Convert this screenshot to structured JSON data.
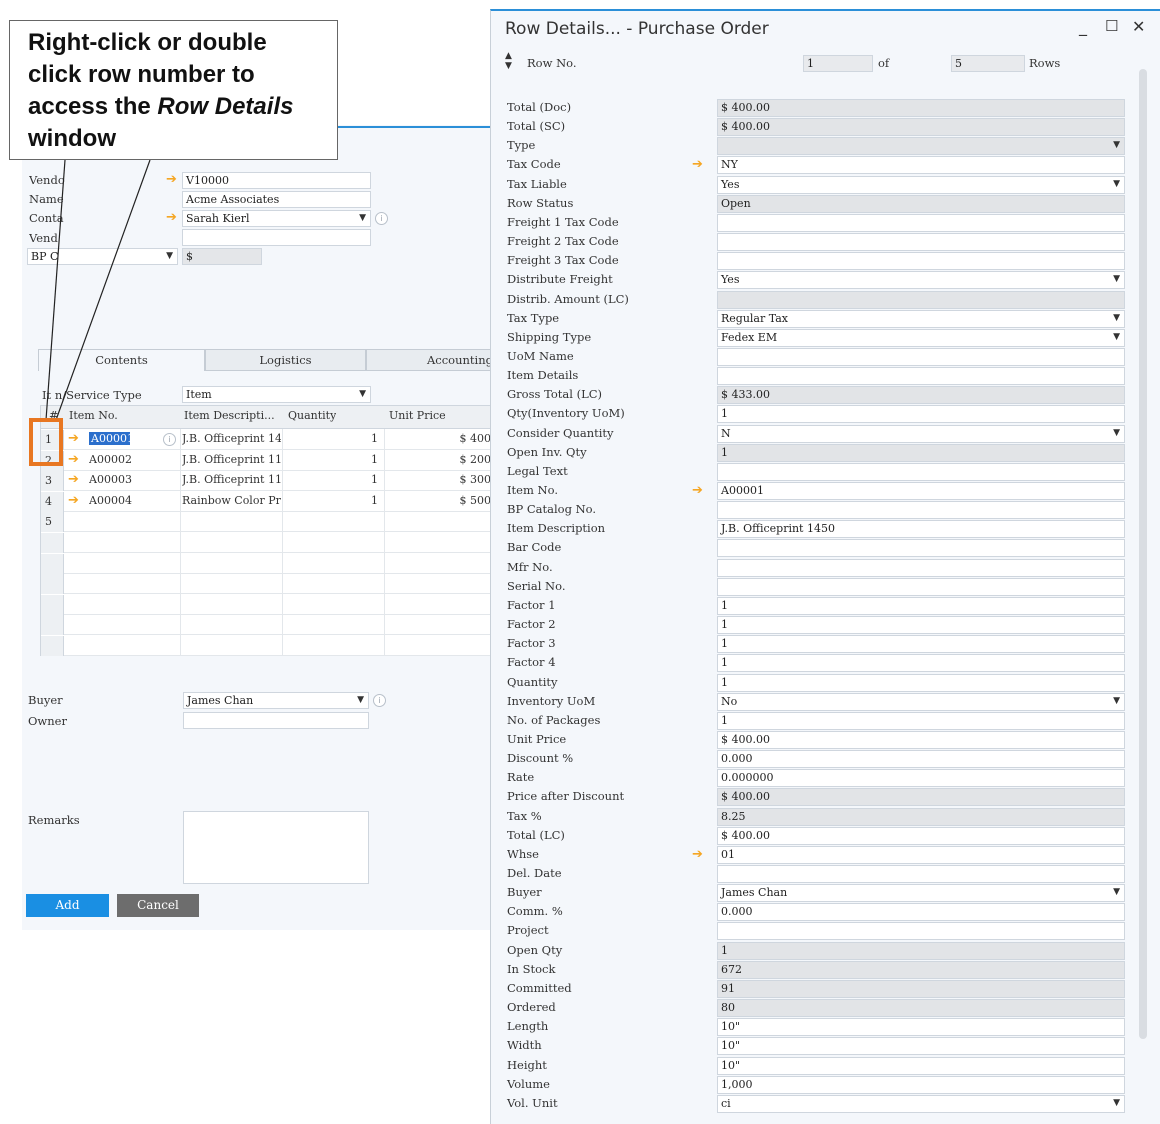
{
  "callout": {
    "line1": "Right-click or double",
    "line2": "click row number to",
    "line3_prefix": "access the ",
    "line3_em": "Row Details",
    "line4": "window"
  },
  "form": {
    "vendor_label": "Vendo",
    "vendor_value": "V10000",
    "name_label": "Name",
    "name_value": "Acme Associates",
    "contact_label": "Conta",
    "contact_value": "Sarah Kierl",
    "vendor_ref_label": "Vend",
    "vendor_ref_suffix": "",
    "bp_currency_label": "BP C",
    "currency_symbol": "$",
    "tabs": [
      "Contents",
      "Logistics",
      "Accounting"
    ],
    "item_service_label": "It  n/Service Type",
    "item_service_value": "Item",
    "grid_headers": [
      "#",
      "Item No.",
      "Item Descripti...",
      "Quantity",
      "Unit Price"
    ],
    "rows": [
      {
        "num": "1",
        "item": "A00001",
        "desc": "J.B. Officeprint 14",
        "qty": "1",
        "price": "$ 400"
      },
      {
        "num": "2",
        "item": "A00002",
        "desc": "J.B. Officeprint 11",
        "qty": "1",
        "price": "$ 200"
      },
      {
        "num": "3",
        "item": "A00003",
        "desc": "J.B. Officeprint 11",
        "qty": "1",
        "price": "$ 300"
      },
      {
        "num": "4",
        "item": "A00004",
        "desc": "Rainbow Color Pr",
        "qty": "1",
        "price": "$ 500"
      },
      {
        "num": "5",
        "item": "",
        "desc": "",
        "qty": "",
        "price": ""
      }
    ],
    "buyer_label": "Buyer",
    "buyer_value": "James Chan",
    "owner_label": "Owner",
    "owner_value": "",
    "remarks_label": "Remarks",
    "add_label": "Add",
    "cancel_label": "Cancel",
    "add_color": "#1a8fe3",
    "cancel_color": "#6d6d6d"
  },
  "row_details": {
    "title": "Row Details... - Purchase Order",
    "row_no_label": "Row No.",
    "row_no_value": "1",
    "of_label": "of",
    "total_rows": "5",
    "rows_label": "Rows",
    "fields": [
      {
        "label": "Total (Doc)",
        "value": "$ 400.00",
        "gray": true
      },
      {
        "label": "Total (SC)",
        "value": "$ 400.00",
        "gray": true
      },
      {
        "label": "Type",
        "value": "",
        "gray": true,
        "dropdown": true
      },
      {
        "label": "Tax Code",
        "value": "NY",
        "arrow": true
      },
      {
        "label": "Tax Liable",
        "value": "Yes",
        "dropdown": true
      },
      {
        "label": "Row Status",
        "value": "Open",
        "gray": true
      },
      {
        "label": "Freight 1 Tax Code",
        "value": ""
      },
      {
        "label": "Freight 2 Tax Code",
        "value": ""
      },
      {
        "label": "Freight 3 Tax Code",
        "value": ""
      },
      {
        "label": "Distribute Freight",
        "value": "Yes",
        "dropdown": true
      },
      {
        "label": "Distrib. Amount (LC)",
        "value": "",
        "gray": true
      },
      {
        "label": "Tax Type",
        "value": "Regular Tax",
        "dropdown": true
      },
      {
        "label": "Shipping Type",
        "value": "Fedex EM",
        "dropdown": true
      },
      {
        "label": "UoM Name",
        "value": ""
      },
      {
        "label": "Item Details",
        "value": ""
      },
      {
        "label": "Gross Total (LC)",
        "value": "$ 433.00",
        "gray": true
      },
      {
        "label": "Qty(Inventory UoM)",
        "value": "1"
      },
      {
        "label": "Consider Quantity",
        "value": "N",
        "dropdown": true
      },
      {
        "label": "Open Inv. Qty",
        "value": "1",
        "gray": true
      },
      {
        "label": "Legal Text",
        "value": ""
      },
      {
        "label": "Item No.",
        "value": "A00001",
        "arrow": true
      },
      {
        "label": "BP Catalog No.",
        "value": ""
      },
      {
        "label": "Item Description",
        "value": "J.B. Officeprint 1450"
      },
      {
        "label": "Bar Code",
        "value": ""
      },
      {
        "label": "Mfr No.",
        "value": ""
      },
      {
        "label": "Serial No.",
        "value": ""
      },
      {
        "label": "Factor 1",
        "value": "1"
      },
      {
        "label": "Factor 2",
        "value": "1"
      },
      {
        "label": "Factor 3",
        "value": "1"
      },
      {
        "label": "Factor 4",
        "value": "1"
      },
      {
        "label": "Quantity",
        "value": "1"
      },
      {
        "label": "Inventory UoM",
        "value": "No",
        "dropdown": true
      },
      {
        "label": "No. of Packages",
        "value": "1"
      },
      {
        "label": "Unit Price",
        "value": "$ 400.00"
      },
      {
        "label": "Discount %",
        "value": "0.000"
      },
      {
        "label": "Rate",
        "value": "0.000000"
      },
      {
        "label": "Price after Discount",
        "value": "$ 400.00",
        "gray": true
      },
      {
        "label": "Tax %",
        "value": "8.25",
        "gray": true
      },
      {
        "label": "Total (LC)",
        "value": "$ 400.00"
      },
      {
        "label": "Whse",
        "value": "01",
        "arrow": true
      },
      {
        "label": "Del. Date",
        "value": ""
      },
      {
        "label": "Buyer",
        "value": "James Chan",
        "dropdown": true
      },
      {
        "label": "Comm. %",
        "value": "0.000"
      },
      {
        "label": "Project",
        "value": ""
      },
      {
        "label": "Open Qty",
        "value": "1",
        "gray": true
      },
      {
        "label": "In Stock",
        "value": "672",
        "gray": true
      },
      {
        "label": "Committed",
        "value": "91",
        "gray": true
      },
      {
        "label": "Ordered",
        "value": "80",
        "gray": true
      },
      {
        "label": "Length",
        "value": "10\""
      },
      {
        "label": "Width",
        "value": "10\""
      },
      {
        "label": "Height",
        "value": "10\""
      },
      {
        "label": "Volume",
        "value": "1,000"
      },
      {
        "label": "Vol. Unit",
        "value": "ci",
        "dropdown": true
      }
    ]
  },
  "colors": {
    "accent": "#2b8fd8",
    "highlight": "#e87722",
    "arrow": "#f5a623"
  }
}
